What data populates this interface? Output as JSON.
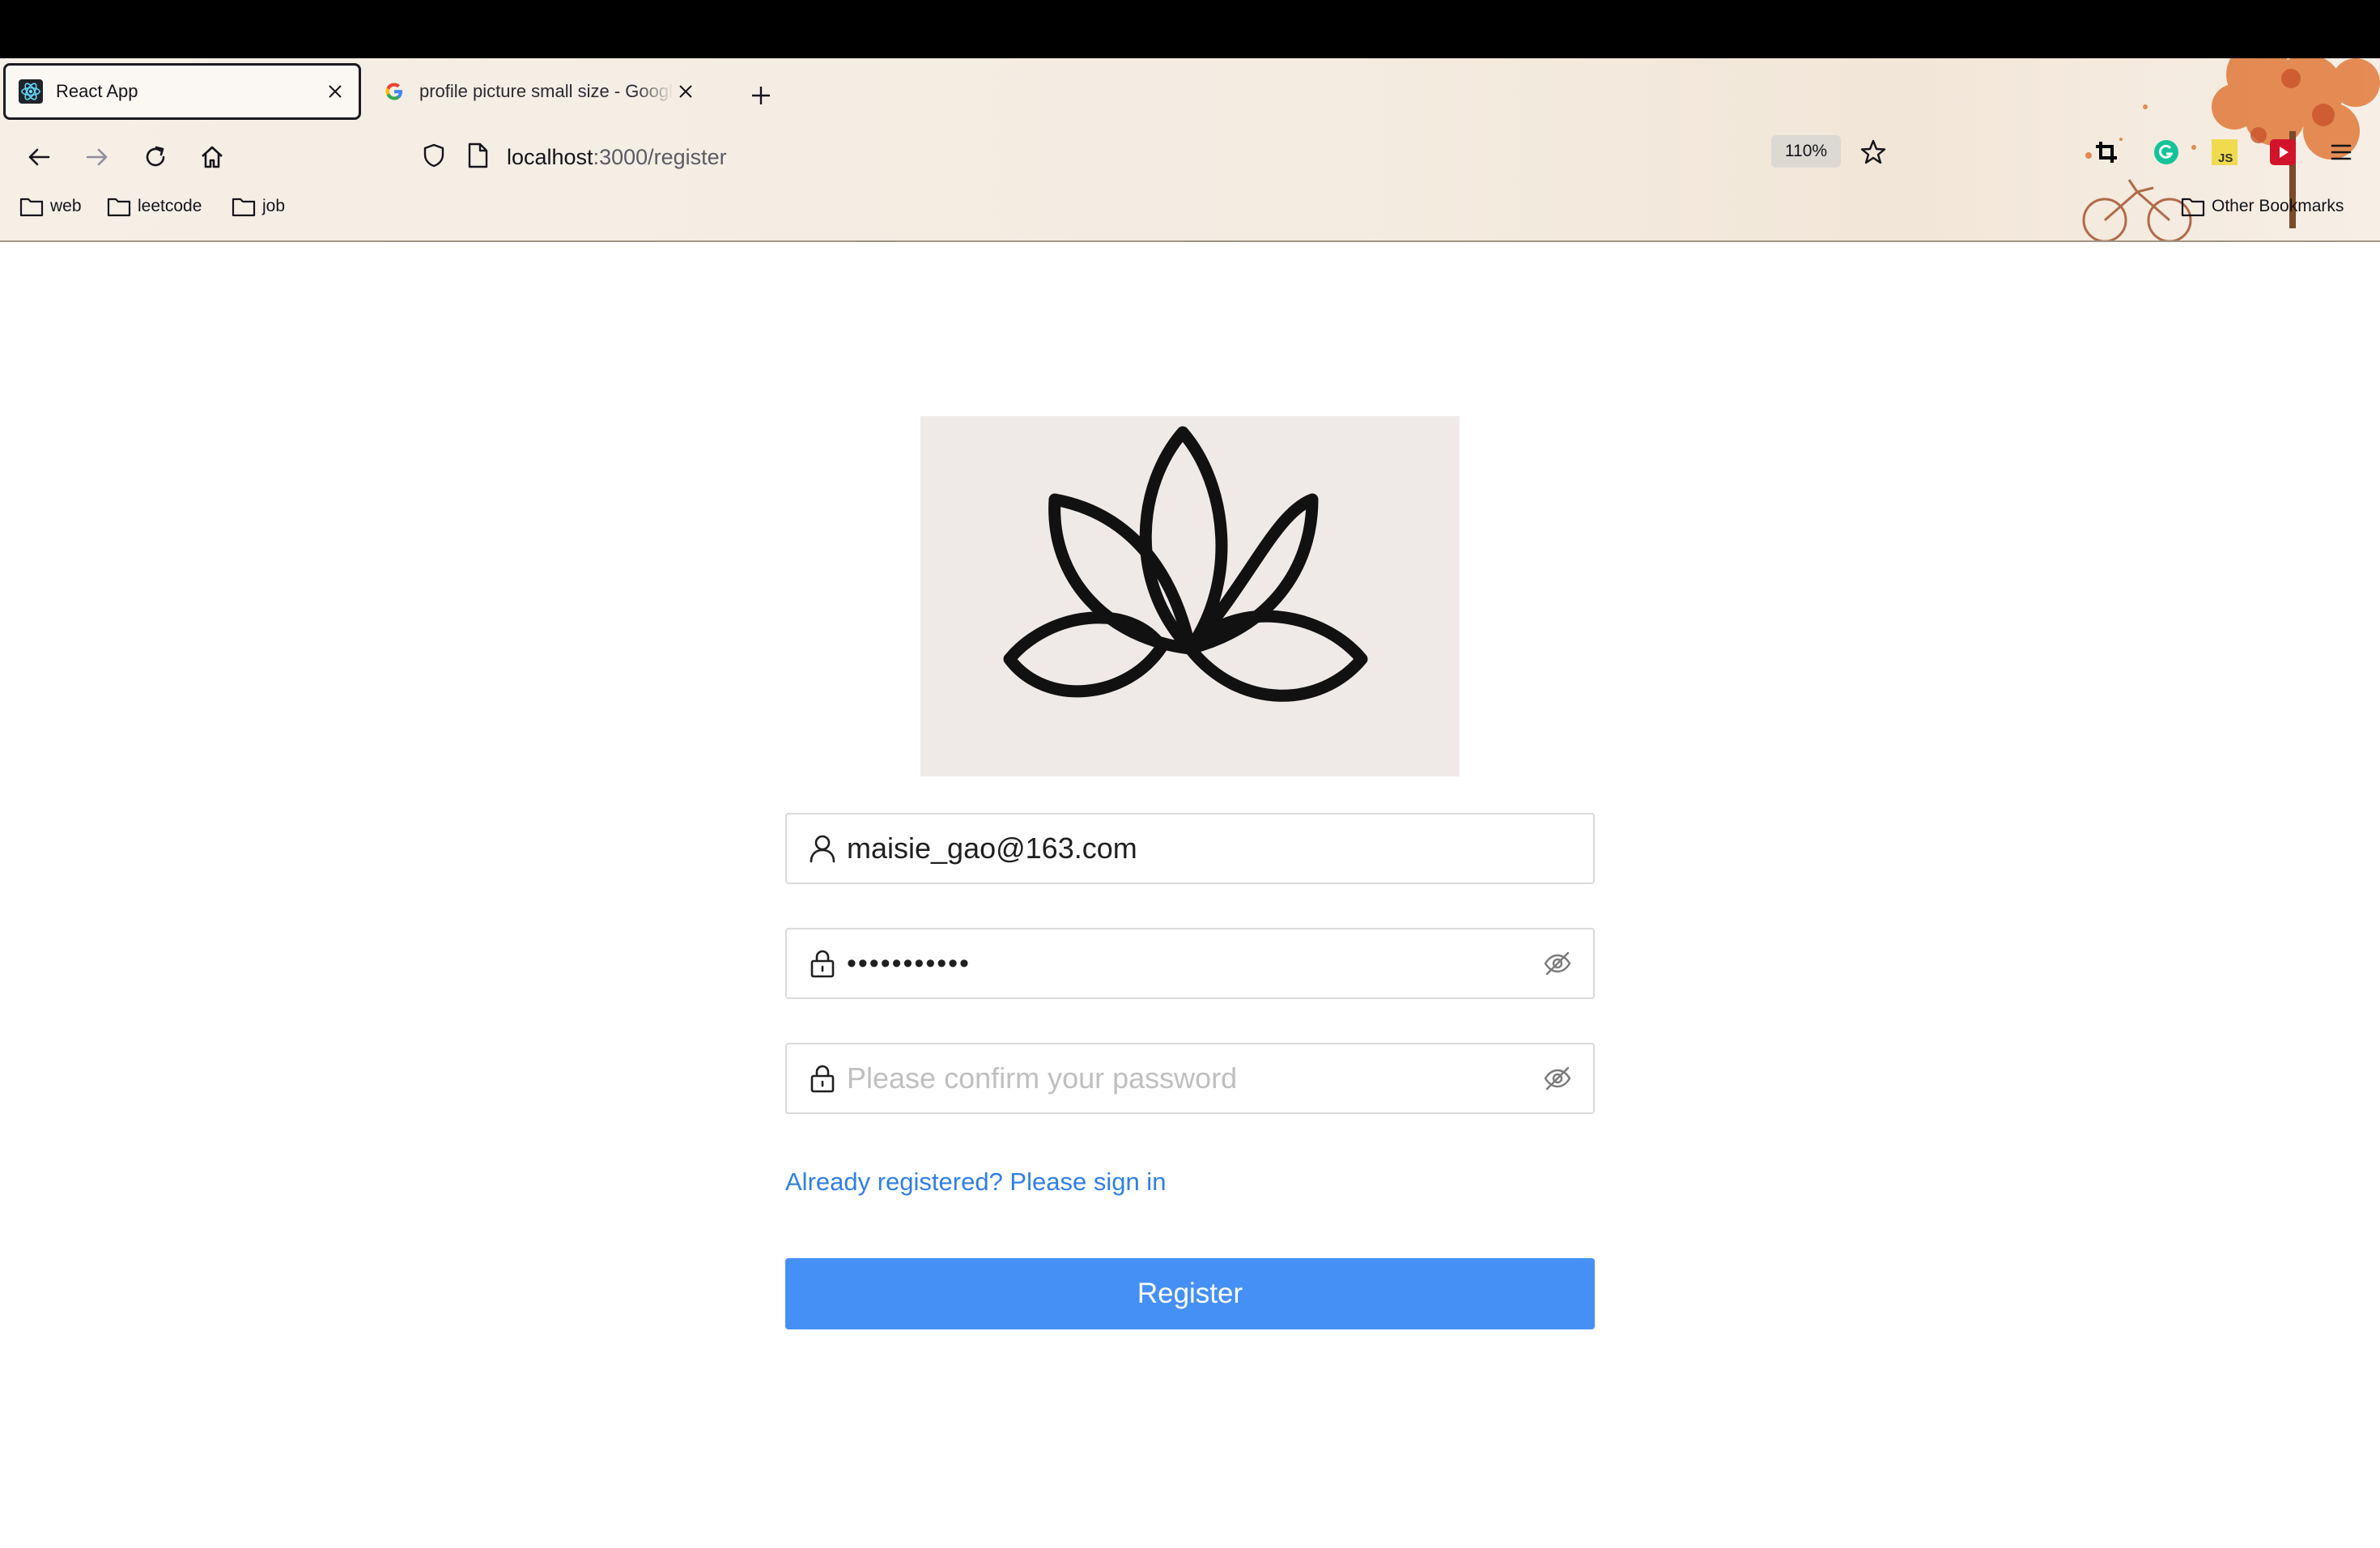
{
  "browser": {
    "tabs": [
      {
        "title": "React App",
        "active": true,
        "favicon": "react-icon"
      },
      {
        "title": "profile picture small size - Google Search",
        "active": false,
        "favicon": "google-icon"
      }
    ],
    "url": {
      "host": "localhost",
      "path": ":3000/register"
    },
    "zoom": "110%",
    "bookmarks": [
      "web",
      "leetcode",
      "job"
    ],
    "other_bookmarks": "Other Bookmarks",
    "extensions": [
      "crop-icon",
      "grammarly-icon",
      "js-extension-icon",
      "youtube-icon"
    ]
  },
  "form": {
    "email_value": "maisie_gao@163.com",
    "password_value": "•••••••••••",
    "confirm_placeholder": "Please confirm your password",
    "signin_link": "Already registered? Please sign in",
    "register_button": "Register"
  },
  "colors": {
    "primary": "#4590f5",
    "link": "#2f7fe6",
    "placeholder": "#bfbfbf"
  }
}
